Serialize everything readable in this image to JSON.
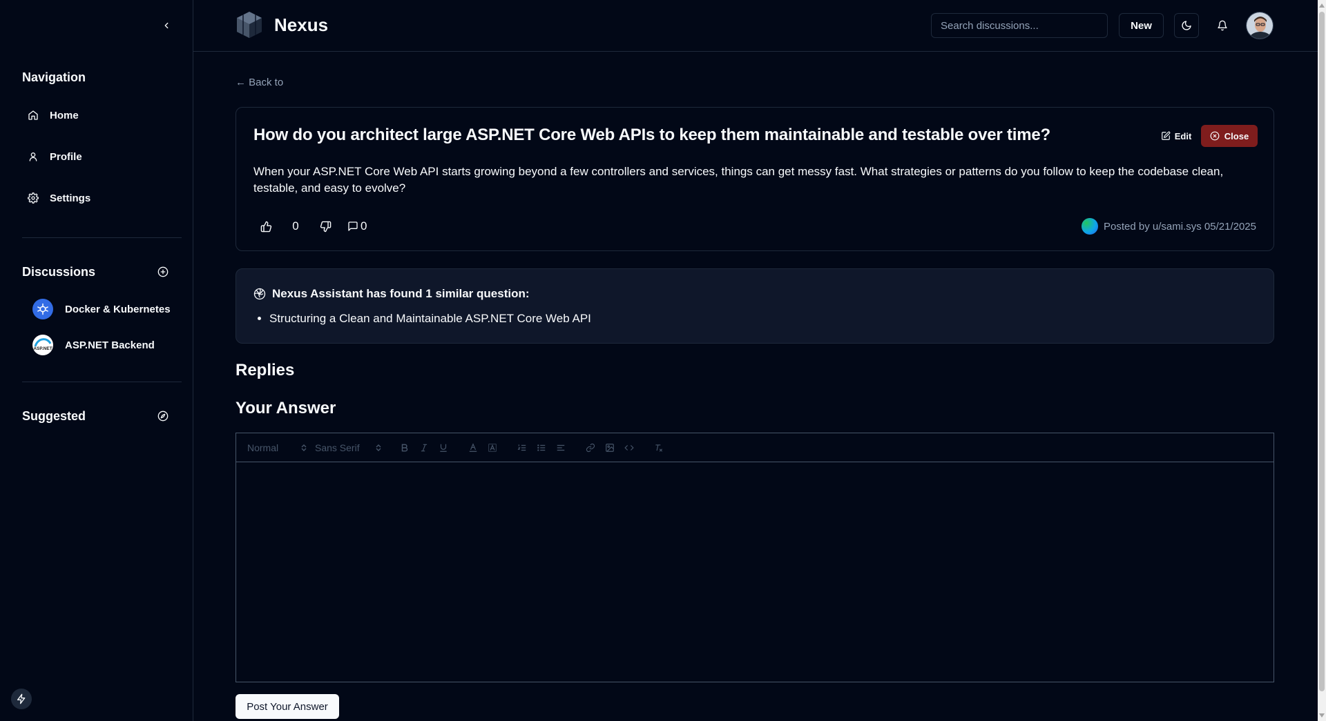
{
  "sidebar": {
    "navigation_title": "Navigation",
    "nav_items": [
      {
        "label": "Home",
        "icon": "home-icon"
      },
      {
        "label": "Profile",
        "icon": "user-icon"
      },
      {
        "label": "Settings",
        "icon": "gear-icon"
      }
    ],
    "discussions_title": "Discussions",
    "discussions": [
      {
        "label": "Docker & Kubernetes",
        "icon": "kubernetes-icon"
      },
      {
        "label": "ASP.NET Backend",
        "icon": "aspnet-icon",
        "logo_text": "ASP.NET"
      }
    ],
    "suggested_title": "Suggested"
  },
  "header": {
    "brand": "Nexus",
    "search_placeholder": "Search discussions...",
    "new_label": "New"
  },
  "main": {
    "back_label": "← Back to",
    "question": {
      "title": "How do you architect large ASP.NET Core Web APIs to keep them maintainable and testable over time?",
      "body": "When your ASP.NET Core Web API starts growing beyond a few controllers and services, things can get messy fast. What strategies or patterns do you follow to keep the codebase clean, testable, and easy to evolve?",
      "edit_label": "Edit",
      "close_label": "Close",
      "votes": "0",
      "comments": "0",
      "posted_by": "Posted by u/sami.sys 05/21/2025"
    },
    "assistant": {
      "heading": "Nexus Assistant has found 1 similar question:",
      "items": [
        "Structuring a Clean and Maintainable ASP.NET Core Web API"
      ]
    },
    "replies_title": "Replies",
    "answer_title": "Your Answer",
    "editor": {
      "format_select": "Normal",
      "font_select": "Sans Serif"
    },
    "post_label": "Post Your Answer"
  },
  "colors": {
    "background": "#020817",
    "border": "#1e293b",
    "muted_text": "#94a3b8",
    "close_button": "#7f1d1d",
    "assistant_card": "#0f172a"
  }
}
